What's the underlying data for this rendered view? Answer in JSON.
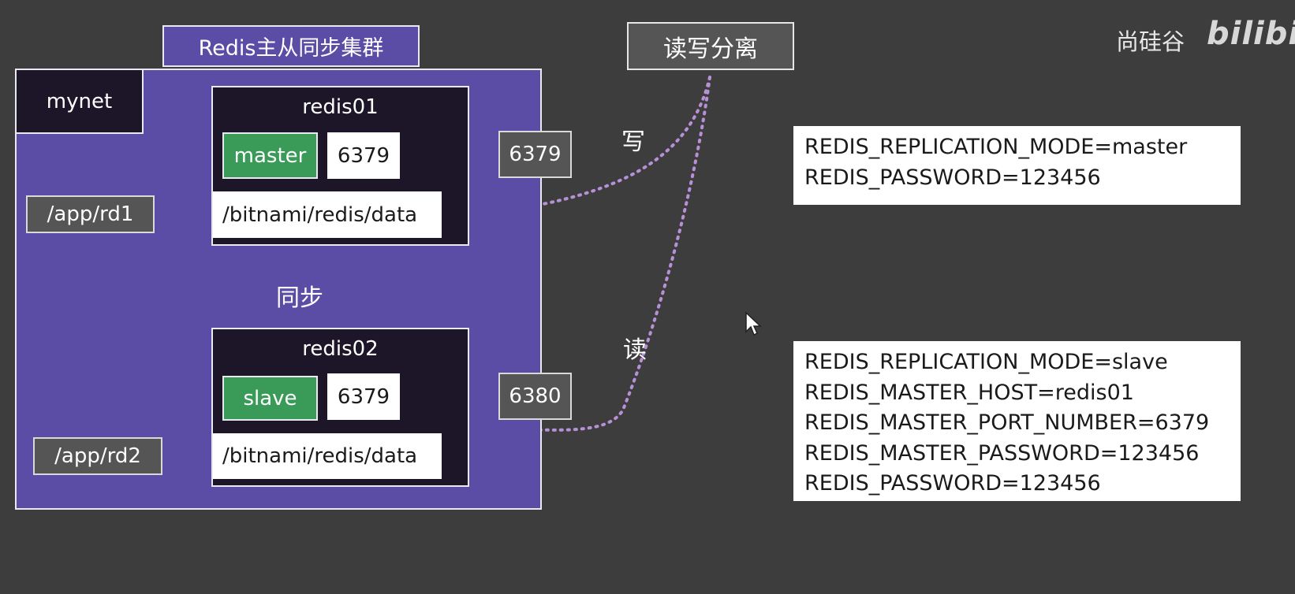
{
  "cluster_title": "Redis主从同步集群",
  "network": "mynet",
  "rw_split": "读写分离",
  "write_label": "写",
  "read_label": "读",
  "sync_label": "同步",
  "containers": [
    {
      "name": "redis01",
      "role": "master",
      "container_port": "6379",
      "host_port": "6379",
      "volume": "/bitnami/redis/data",
      "host_dir": "/app/rd1"
    },
    {
      "name": "redis02",
      "role": "slave",
      "container_port": "6379",
      "host_port": "6380",
      "volume": "/bitnami/redis/data",
      "host_dir": "/app/rd2"
    }
  ],
  "env_master": [
    "REDIS_REPLICATION_MODE=master",
    "REDIS_PASSWORD=123456"
  ],
  "env_slave": [
    "REDIS_REPLICATION_MODE=slave",
    "REDIS_MASTER_HOST=redis01",
    "REDIS_MASTER_PORT_NUMBER=6379",
    "REDIS_MASTER_PASSWORD=123456",
    "REDIS_PASSWORD=123456"
  ],
  "brand": "尚硅谷",
  "logo": "bilibili",
  "colors": {
    "background": "#3d3d3d",
    "network": "#5b4ca6",
    "container": "#1d1628",
    "role": "#3a9a58",
    "link_purple": "#a98ad8",
    "link_red": "#e04848"
  }
}
